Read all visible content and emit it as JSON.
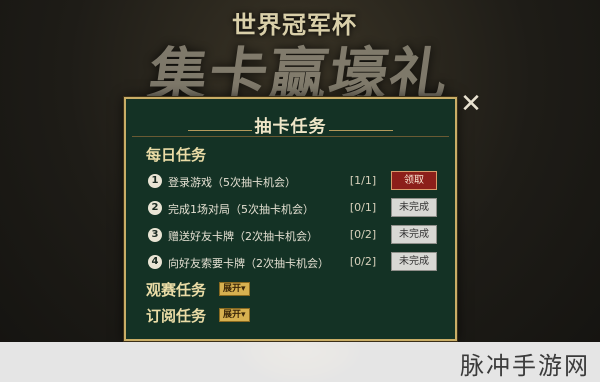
{
  "background": {
    "banner_small": "世界冠军杯",
    "banner_big": "集卡赢壕礼"
  },
  "panel": {
    "title": "抽卡任务",
    "close_symbol": "✕",
    "daily": {
      "header": "每日任务",
      "tasks": [
        {
          "index": "1",
          "text": "登录游戏（5次抽卡机会）",
          "progress": "[1/1]",
          "button": "领取",
          "state": "claimable"
        },
        {
          "index": "2",
          "text": "完成1场对局（5次抽卡机会）",
          "progress": "[0/1]",
          "button": "未完成",
          "state": "incomplete"
        },
        {
          "index": "3",
          "text": "赠送好友卡牌（2次抽卡机会）",
          "progress": "[0/2]",
          "button": "未完成",
          "state": "incomplete"
        },
        {
          "index": "4",
          "text": "向好友索要卡牌（2次抽卡机会）",
          "progress": "[0/2]",
          "button": "未完成",
          "state": "incomplete"
        }
      ]
    },
    "watch": {
      "header": "观赛任务",
      "expand_label": "展开▾"
    },
    "subscribe": {
      "header": "订阅任务",
      "expand_label": "展开▾"
    }
  },
  "watermark": "脉冲手游网",
  "colors": {
    "panel_bg": "#143225",
    "panel_border": "#c9ad66",
    "claim_button": "#8c1f1a",
    "incomplete_button": "#d8d8d4",
    "section_header": "#eadca6"
  }
}
